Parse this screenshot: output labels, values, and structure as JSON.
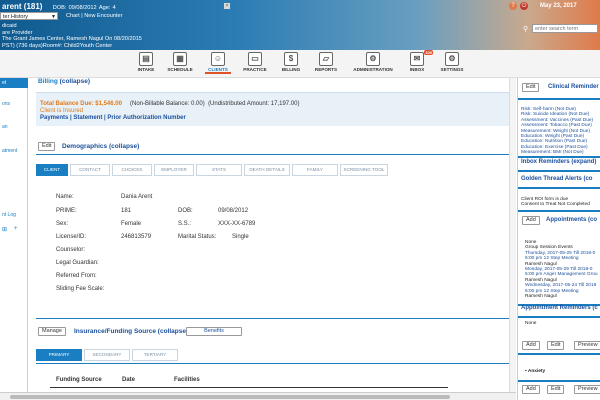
{
  "header": {
    "patient_title": "arent (181)",
    "dob_label": "DOB:",
    "dob_value": "09/08/2012",
    "age_label": "Age:",
    "age_value": "4",
    "history_select": "ter History",
    "chart_link": "Chart | New Encounter",
    "line1": "dicaid",
    "line2": "are Provider",
    "line3": "The Grant James Center, Ramesh Nagul On 08/20/2015",
    "line4": "PST) (736 days)Room#: Child2Youth Center",
    "date": "May 23, 2017",
    "search_placeholder": "enter search term",
    "help_icon": "?",
    "power_icon": "⏻"
  },
  "toolbar": {
    "items": [
      {
        "label": "INTAKE",
        "icon": "intake-icon",
        "glyph": "▤"
      },
      {
        "label": "SCHEDULE",
        "icon": "calendar-icon",
        "glyph": "▦"
      },
      {
        "label": "CLIENTS",
        "icon": "client-icon",
        "glyph": "☺"
      },
      {
        "label": "PRACTICE",
        "icon": "practice-icon",
        "glyph": "▭"
      },
      {
        "label": "BILLING",
        "icon": "billing-icon",
        "glyph": "$"
      },
      {
        "label": "REPORTS",
        "icon": "folder-icon",
        "glyph": "▱"
      },
      {
        "label": "ADMINISTRATION",
        "icon": "admin-icon",
        "glyph": "⚙"
      },
      {
        "label": "INBOX",
        "icon": "envelope-icon",
        "glyph": "✉",
        "badge": "100"
      },
      {
        "label": "SETTINGS",
        "icon": "gear-icon",
        "glyph": "⚙"
      }
    ]
  },
  "leftnav": {
    "active": "et",
    "items": [
      "ons",
      "an",
      "atment",
      "nt Log"
    ]
  },
  "billing": {
    "title": "Billing",
    "collapse": "(collapse)",
    "balance_due": "Total Balance Due: $1,546.00",
    "non_billable": "(Non-Billable Balance: 0.00)",
    "undistributed": "(Undistributed Amount: 17,197.00)",
    "insured": "Client is Insured",
    "links": "Payments | Statement | Prior Authorization Number"
  },
  "demographics": {
    "edit": "Edit",
    "title": "Demographics",
    "collapse": "(collapse)",
    "tabs": [
      "CLIENT",
      "CONTACT",
      "CHOICES",
      "EMPLOYER",
      "STATS",
      "DEATH DETAILS",
      "FAMILY",
      "SCREENING TOOL"
    ],
    "fields": {
      "name_label": "Name:",
      "name_value": "Dania  Arent",
      "prime_label": "PRIME:",
      "prime_value": "181",
      "dob_label": "DOB:",
      "dob_value": "09/08/2012",
      "sex_label": "Sex:",
      "sex_value": "Female",
      "ss_label": "S.S.:",
      "ss_value": "XXX-XX-6789",
      "license_label": "License/ID:",
      "license_value": "246813579",
      "marital_label": "Marital Status:",
      "marital_value": "Single",
      "counselor_label": "Counselor:",
      "guardian_label": "Legal Guardian:",
      "referred_label": "Referred From:",
      "sliding_label": "Sliding Fee Scale:"
    }
  },
  "insurance": {
    "manage": "Manage",
    "title": "Insurance/Funding Source",
    "collapse": "(collapse)",
    "benefits": "Benefits",
    "tabs": [
      "PRIMARY",
      "SECONDARY",
      "TERTIARY"
    ],
    "columns": [
      "Funding Source",
      "Date",
      "Facilities"
    ]
  },
  "right": {
    "edit": "Edit",
    "clinical_title": "Clinical Reminder",
    "clinical_items": [
      "Risk: Self-harm (Not Due)",
      "Risk: Suicide Ideation (Not Due)",
      "Assessment: Vaccines (Past Due)",
      "Assessment: Tobacco (Past Due)",
      "Measurement: Weight (Not Due)",
      "Education: Weight (Past Due)",
      "Education: Nutrition (Past Due)",
      "Education: Exercise (Past Due)",
      "Measurement: BMI (Not Due)"
    ],
    "inbox_title": "Inbox Reminders (expand)",
    "golden_title": "Golden Thread Alerts (co",
    "golden_items": [
      "Client ROI form is due",
      "Consent to Treat Not Completed"
    ],
    "add": "Add",
    "appointments_title": "Appointments (co",
    "appt_items": [
      "None",
      "Group Session Events",
      "Thursday, 2017-05-25 Till 2018-0",
      "6:00 pm 12 Step Meeting",
      "Ramesh Nagul",
      "Monday, 2017-05-29 Till 2018-0",
      "5:00 pm Anger Management Grou",
      "Ramesh Nagul",
      "Wednesday, 2017-05-24 Till 2018",
      "6:00 pm 12 Step Meeting",
      "Ramesh Nagul"
    ],
    "appt_reminders_title": "Appointment Reminders (c",
    "none": "None",
    "buttons": [
      "Add",
      "Edit",
      "Preview"
    ],
    "anxiety": "Anxiety"
  }
}
